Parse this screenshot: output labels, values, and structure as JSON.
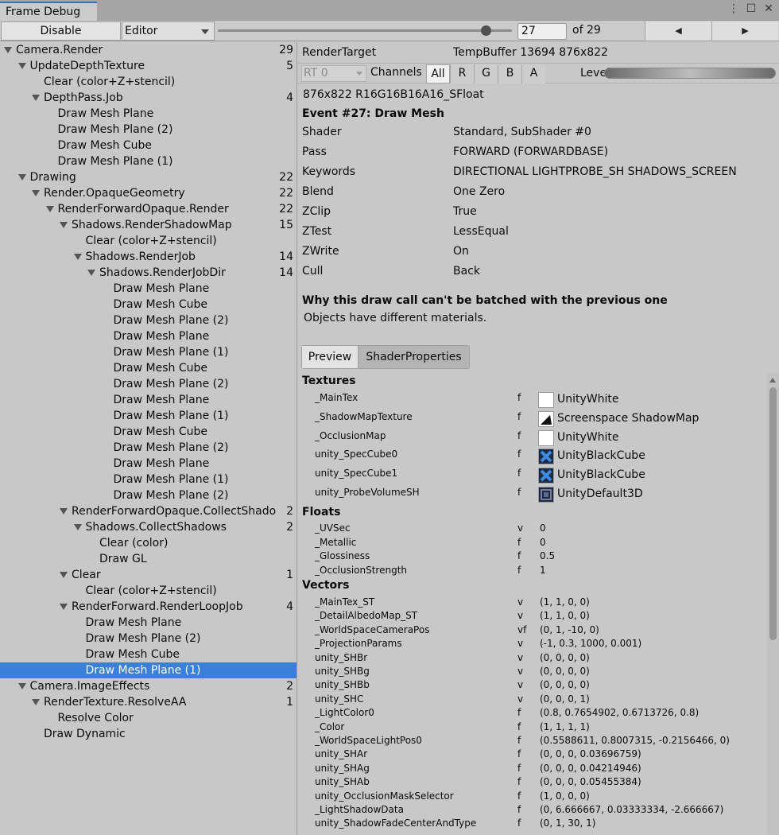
{
  "window": {
    "tab_title": "Frame Debug",
    "controls": [
      "⋮",
      "☐",
      "✕"
    ]
  },
  "toolbar": {
    "disable_label": "Disable",
    "target_dropdown": "Editor",
    "frame_value": "27",
    "frame_total": "of 29",
    "slider_fraction": 0.9286
  },
  "tree": [
    {
      "label": "Camera.Render",
      "count": "29",
      "level": 0,
      "expanded": true
    },
    {
      "label": "UpdateDepthTexture",
      "count": "5",
      "level": 1,
      "expanded": true
    },
    {
      "label": "Clear (color+Z+stencil)",
      "count": "",
      "level": 2,
      "expanded": null
    },
    {
      "label": "DepthPass.Job",
      "count": "4",
      "level": 2,
      "expanded": true
    },
    {
      "label": "Draw Mesh Plane",
      "count": "",
      "level": 3,
      "expanded": null
    },
    {
      "label": "Draw Mesh Plane (2)",
      "count": "",
      "level": 3,
      "expanded": null
    },
    {
      "label": "Draw Mesh Cube",
      "count": "",
      "level": 3,
      "expanded": null
    },
    {
      "label": "Draw Mesh Plane (1)",
      "count": "",
      "level": 3,
      "expanded": null
    },
    {
      "label": "Drawing",
      "count": "22",
      "level": 1,
      "expanded": true
    },
    {
      "label": "Render.OpaqueGeometry",
      "count": "22",
      "level": 2,
      "expanded": true
    },
    {
      "label": "RenderForwardOpaque.Render",
      "count": "22",
      "level": 3,
      "expanded": true
    },
    {
      "label": "Shadows.RenderShadowMap",
      "count": "15",
      "level": 4,
      "expanded": true
    },
    {
      "label": "Clear (color+Z+stencil)",
      "count": "",
      "level": 5,
      "expanded": null
    },
    {
      "label": "Shadows.RenderJob",
      "count": "14",
      "level": 5,
      "expanded": true
    },
    {
      "label": "Shadows.RenderJobDir",
      "count": "14",
      "level": 6,
      "expanded": true
    },
    {
      "label": "Draw Mesh Plane",
      "count": "",
      "level": 7,
      "expanded": null
    },
    {
      "label": "Draw Mesh Cube",
      "count": "",
      "level": 7,
      "expanded": null
    },
    {
      "label": "Draw Mesh Plane (2)",
      "count": "",
      "level": 7,
      "expanded": null
    },
    {
      "label": "Draw Mesh Plane",
      "count": "",
      "level": 7,
      "expanded": null
    },
    {
      "label": "Draw Mesh Plane (1)",
      "count": "",
      "level": 7,
      "expanded": null
    },
    {
      "label": "Draw Mesh Cube",
      "count": "",
      "level": 7,
      "expanded": null
    },
    {
      "label": "Draw Mesh Plane (2)",
      "count": "",
      "level": 7,
      "expanded": null
    },
    {
      "label": "Draw Mesh Plane",
      "count": "",
      "level": 7,
      "expanded": null
    },
    {
      "label": "Draw Mesh Plane (1)",
      "count": "",
      "level": 7,
      "expanded": null
    },
    {
      "label": "Draw Mesh Cube",
      "count": "",
      "level": 7,
      "expanded": null
    },
    {
      "label": "Draw Mesh Plane (2)",
      "count": "",
      "level": 7,
      "expanded": null
    },
    {
      "label": "Draw Mesh Plane",
      "count": "",
      "level": 7,
      "expanded": null
    },
    {
      "label": "Draw Mesh Plane (1)",
      "count": "",
      "level": 7,
      "expanded": null
    },
    {
      "label": "Draw Mesh Plane (2)",
      "count": "",
      "level": 7,
      "expanded": null
    },
    {
      "label": "RenderForwardOpaque.CollectShado",
      "count": "2",
      "level": 4,
      "expanded": true
    },
    {
      "label": "Shadows.CollectShadows",
      "count": "2",
      "level": 5,
      "expanded": true
    },
    {
      "label": "Clear (color)",
      "count": "",
      "level": 6,
      "expanded": null
    },
    {
      "label": "Draw GL",
      "count": "",
      "level": 6,
      "expanded": null
    },
    {
      "label": "Clear",
      "count": "1",
      "level": 4,
      "expanded": true
    },
    {
      "label": "Clear (color+Z+stencil)",
      "count": "",
      "level": 5,
      "expanded": null
    },
    {
      "label": "RenderForward.RenderLoopJob",
      "count": "4",
      "level": 4,
      "expanded": true
    },
    {
      "label": "Draw Mesh Plane",
      "count": "",
      "level": 5,
      "expanded": null
    },
    {
      "label": "Draw Mesh Plane (2)",
      "count": "",
      "level": 5,
      "expanded": null
    },
    {
      "label": "Draw Mesh Cube",
      "count": "",
      "level": 5,
      "expanded": null
    },
    {
      "label": "Draw Mesh Plane (1)",
      "count": "",
      "level": 5,
      "expanded": null,
      "selected": true
    },
    {
      "label": "Camera.ImageEffects",
      "count": "2",
      "level": 1,
      "expanded": true
    },
    {
      "label": "RenderTexture.ResolveAA",
      "count": "1",
      "level": 2,
      "expanded": true
    },
    {
      "label": "Resolve Color",
      "count": "",
      "level": 3,
      "expanded": null
    },
    {
      "label": "Draw Dynamic",
      "count": "",
      "level": 2,
      "expanded": null
    }
  ],
  "detail": {
    "render_target_label": "RenderTarget",
    "render_target_value": "TempBuffer 13694 876x822",
    "rt_dropdown": "RT 0",
    "channels_label": "Channels",
    "channels": [
      "All",
      "R",
      "G",
      "B",
      "A"
    ],
    "active_channel": "All",
    "levels_label": "Levels",
    "format": "876x822 R16G16B16A16_SFloat",
    "event_title": "Event #27: Draw Mesh",
    "props": [
      {
        "key": "Shader",
        "value": "Standard, SubShader #0"
      },
      {
        "key": "Pass",
        "value": "FORWARD (FORWARDBASE)"
      },
      {
        "key": "Keywords",
        "value": "DIRECTIONAL LIGHTPROBE_SH SHADOWS_SCREEN"
      },
      {
        "key": "Blend",
        "value": "One Zero"
      },
      {
        "key": "ZClip",
        "value": "True"
      },
      {
        "key": "ZTest",
        "value": "LessEqual"
      },
      {
        "key": "ZWrite",
        "value": "On"
      },
      {
        "key": "Cull",
        "value": "Back"
      }
    ],
    "batch_title": "Why this draw call can't be batched with the previous one",
    "batch_reason": "Objects have different materials.",
    "tabs": [
      "Preview",
      "ShaderProperties"
    ],
    "active_tab": "ShaderProperties"
  },
  "shader_props": {
    "textures_title": "Textures",
    "textures": [
      {
        "name": "_MainTex",
        "type": "f",
        "value": "UnityWhite",
        "thumb": "white"
      },
      {
        "name": "_ShadowMapTexture",
        "type": "f",
        "value": "Screenspace ShadowMap",
        "thumb": "shadow"
      },
      {
        "name": "_OcclusionMap",
        "type": "f",
        "value": "UnityWhite",
        "thumb": "white"
      },
      {
        "name": "unity_SpecCube0",
        "type": "f",
        "value": "UnityBlackCube",
        "thumb": "cube"
      },
      {
        "name": "unity_SpecCube1",
        "type": "f",
        "value": "UnityBlackCube",
        "thumb": "cube"
      },
      {
        "name": "unity_ProbeVolumeSH",
        "type": "f",
        "value": "UnityDefault3D",
        "thumb": "3d"
      }
    ],
    "floats_title": "Floats",
    "floats": [
      {
        "name": "_UVSec",
        "type": "v",
        "value": "0"
      },
      {
        "name": "_Metallic",
        "type": "f",
        "value": "0"
      },
      {
        "name": "_Glossiness",
        "type": "f",
        "value": "0.5"
      },
      {
        "name": "_OcclusionStrength",
        "type": "f",
        "value": "1"
      }
    ],
    "vectors_title": "Vectors",
    "vectors": [
      {
        "name": "_MainTex_ST",
        "type": "v",
        "value": "(1, 1, 0, 0)"
      },
      {
        "name": "_DetailAlbedoMap_ST",
        "type": "v",
        "value": "(1, 1, 0, 0)"
      },
      {
        "name": "_WorldSpaceCameraPos",
        "type": "vf",
        "value": "(0, 1, -10, 0)"
      },
      {
        "name": "_ProjectionParams",
        "type": "v",
        "value": "(-1, 0.3, 1000, 0.001)"
      },
      {
        "name": "unity_SHBr",
        "type": "v",
        "value": "(0, 0, 0, 0)"
      },
      {
        "name": "unity_SHBg",
        "type": "v",
        "value": "(0, 0, 0, 0)"
      },
      {
        "name": "unity_SHBb",
        "type": "v",
        "value": "(0, 0, 0, 0)"
      },
      {
        "name": "unity_SHC",
        "type": "v",
        "value": "(0, 0, 0, 1)"
      },
      {
        "name": "_LightColor0",
        "type": "f",
        "value": "(0.8, 0.7654902, 0.6713726, 0.8)"
      },
      {
        "name": "_Color",
        "type": "f",
        "value": "(1, 1, 1, 1)"
      },
      {
        "name": "_WorldSpaceLightPos0",
        "type": "f",
        "value": "(0.5588611, 0.8007315, -0.2156466, 0)"
      },
      {
        "name": "unity_SHAr",
        "type": "f",
        "value": "(0, 0, 0, 0.03696759)"
      },
      {
        "name": "unity_SHAg",
        "type": "f",
        "value": "(0, 0, 0, 0.04214946)"
      },
      {
        "name": "unity_SHAb",
        "type": "f",
        "value": "(0, 0, 0, 0.05455384)"
      },
      {
        "name": "unity_OcclusionMaskSelector",
        "type": "f",
        "value": "(1, 0, 0, 0)"
      },
      {
        "name": "_LightShadowData",
        "type": "f",
        "value": "(0, 6.666667, 0.03333334, -2.666667)"
      },
      {
        "name": "unity_ShadowFadeCenterAndType",
        "type": "f",
        "value": "(0, 1, 30, 1)"
      }
    ]
  },
  "colors": {
    "selection": "#3a7fd8",
    "panel": "#c8c8c8",
    "tab_accent": "#3a72b0"
  }
}
